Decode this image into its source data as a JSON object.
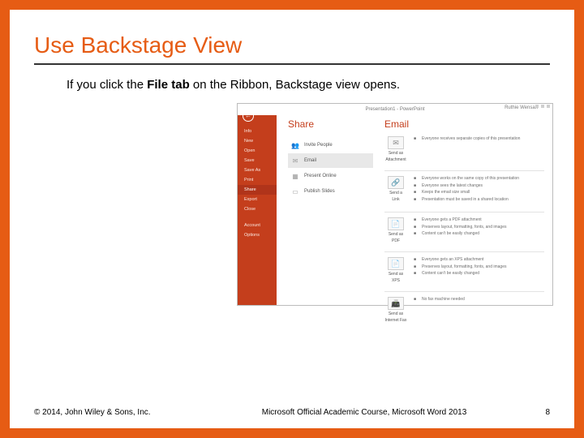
{
  "slide": {
    "title": "Use Backstage View",
    "body_prefix": "If you click the ",
    "body_bold": "File tab",
    "body_suffix": " on the Ribbon, Backstage view opens."
  },
  "app": {
    "window_title": "Presentation1 - PowerPoint",
    "user": "Ruthie Wensan",
    "sidebar": {
      "items": [
        "Info",
        "New",
        "Open",
        "Save",
        "Save As",
        "Print",
        "Share",
        "Export",
        "Close",
        "",
        "Account",
        "Options"
      ],
      "active_index": 6
    },
    "share": {
      "heading": "Share",
      "items": [
        {
          "icon": "👥",
          "label": "Invite People"
        },
        {
          "icon": "✉",
          "label": "Email"
        },
        {
          "icon": "▦",
          "label": "Present Online"
        },
        {
          "icon": "▭",
          "label": "Publish Slides"
        }
      ],
      "active_index": 1
    },
    "email": {
      "heading": "Email",
      "blocks": [
        {
          "button": {
            "icon": "✉",
            "label1": "Send as",
            "label2": "Attachment"
          },
          "bullets": [
            "Everyone receives separate copies of this presentation"
          ]
        },
        {
          "button": {
            "icon": "🔗",
            "label1": "Send a",
            "label2": "Link"
          },
          "bullets": [
            "Everyone works on the same copy of this presentation",
            "Everyone sees the latest changes",
            "Keeps the email size small",
            "Presentation must be saved in a shared location"
          ]
        },
        {
          "button": {
            "icon": "📄",
            "label1": "Send as",
            "label2": "PDF"
          },
          "bullets": [
            "Everyone gets a PDF attachment",
            "Preserves layout, formatting, fonts, and images",
            "Content can't be easily changed"
          ]
        },
        {
          "button": {
            "icon": "📄",
            "label1": "Send as",
            "label2": "XPS"
          },
          "bullets": [
            "Everyone gets an XPS attachment",
            "Preserves layout, formatting, fonts, and images",
            "Content can't be easily changed"
          ]
        },
        {
          "button": {
            "icon": "📠",
            "label1": "Send as",
            "label2": "Internet Fax"
          },
          "bullets": [
            "No fax machine needed"
          ]
        }
      ]
    }
  },
  "footer": {
    "copyright": "© 2014, John Wiley & Sons, Inc.",
    "course": "Microsoft Official Academic Course, Microsoft Word 2013",
    "page": "8"
  }
}
